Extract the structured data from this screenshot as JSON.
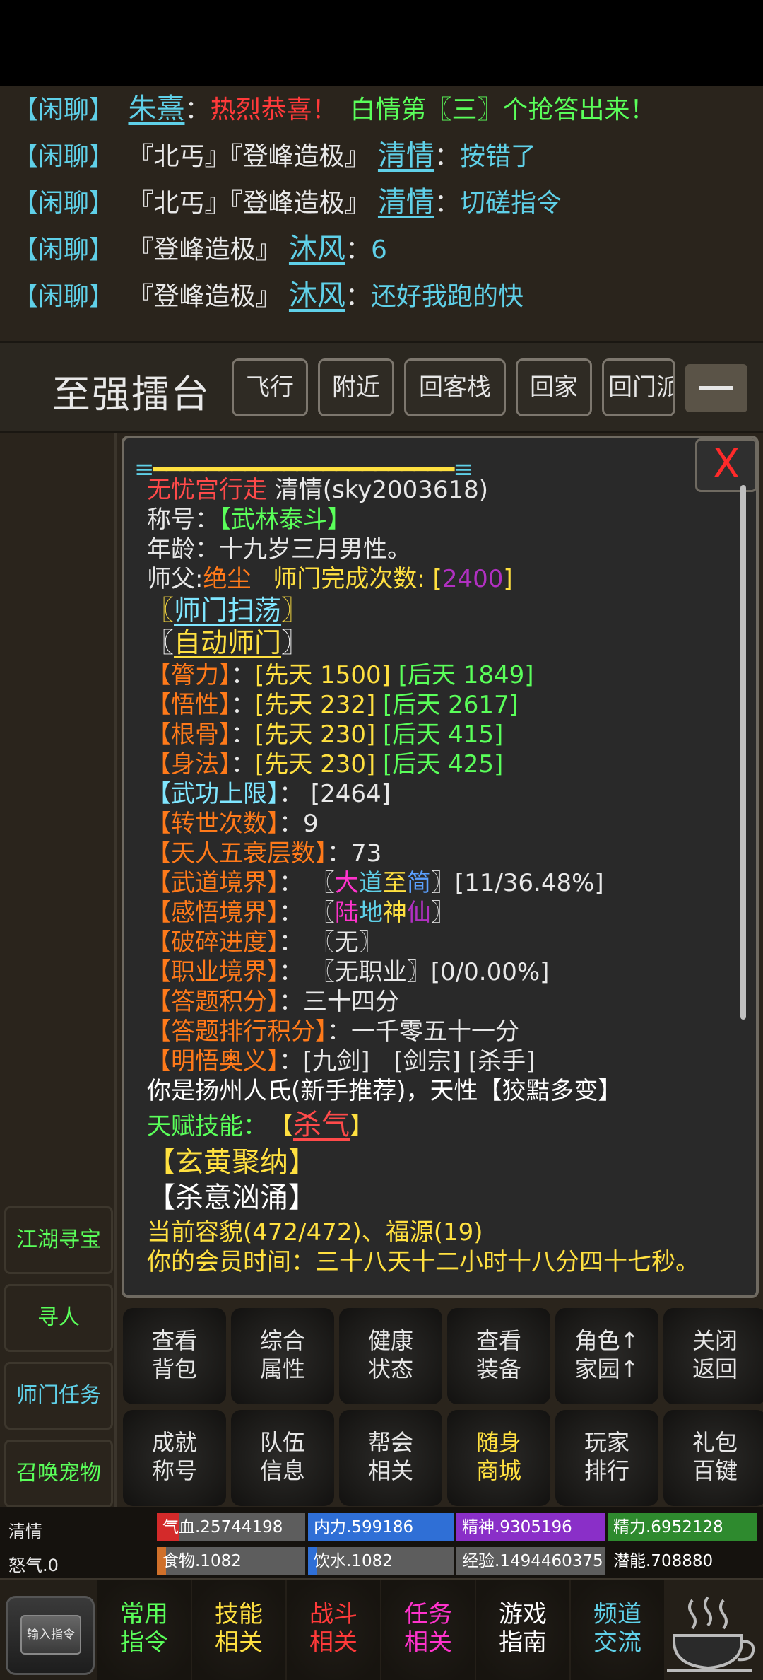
{
  "chat": {
    "lines": [
      {
        "tag": "【闲聊】",
        "title": "",
        "nick": "朱熹",
        "colon": "：",
        "msg_red": "热烈恭喜！",
        "msg_green": "白情第〖三〗个抢答出来！"
      },
      {
        "tag": "【闲聊】",
        "title": "『北丐』『登峰造极』",
        "nick": "清情",
        "colon": "：",
        "msg": "按错了"
      },
      {
        "tag": "【闲聊】",
        "title": "『北丐』『登峰造极』",
        "nick": "清情",
        "colon": "：",
        "msg": "切磋指令"
      },
      {
        "tag": "【闲聊】",
        "title": "『登峰造极』",
        "nick": "沐风",
        "colon": "：",
        "msg": "6"
      },
      {
        "tag": "【闲聊】",
        "title": "『登峰造极』",
        "nick": "沐风",
        "colon": "：",
        "msg": "还好我跑的快"
      }
    ]
  },
  "header": {
    "location": "至强擂台",
    "buttons": [
      "飞行",
      "附近",
      "回客栈",
      "回家",
      "回门派"
    ]
  },
  "side": {
    "buttons": [
      {
        "label": "江湖寻宝",
        "color": "#5aff5a"
      },
      {
        "label": "寻人",
        "color": "#5aff5a"
      },
      {
        "label": "师门任务",
        "color": "#5fd0e8"
      },
      {
        "label": "召唤宠物",
        "color": "#5aff5a"
      }
    ]
  },
  "panel": {
    "close": "X",
    "sect_name": "无忧宫行走",
    "player": "清情(sky2003618)",
    "title_label": "称号：",
    "title_value": "【武林泰斗】",
    "age": "年龄：十九岁三月男性。",
    "master_label": "师父:",
    "master_name": "绝尘",
    "sect_count_label": "师门完成次数: [",
    "sect_count": "2400",
    "sect_count_end": "]",
    "link1": "师门扫荡",
    "link2": "自动师门",
    "attrs": [
      {
        "name": "【膂力】",
        "colon": "：",
        "base": "[先天 1500]",
        "acq": "[后天 1849]"
      },
      {
        "name": "【悟性】",
        "colon": "：",
        "base": "[先天 232]",
        "acq": "[后天 2617]"
      },
      {
        "name": "【根骨】",
        "colon": "：",
        "base": "[先天 230]",
        "acq": "[后天 415]"
      },
      {
        "name": "【身法】",
        "colon": "：",
        "base": "[先天 230]",
        "acq": "[后天 425]"
      }
    ],
    "wugong_limit_label": "【武功上限】",
    "wugong_limit": "：  [2464]",
    "rebirth_label": "【转世次数】",
    "rebirth": "：9",
    "wushuai_label": "【天人五衰层数】",
    "wushuai": "：73",
    "wudao_label": "【武道境界】",
    "wudao_pre": "：  〖",
    "wudao_chars": [
      "大",
      "道",
      "至",
      "简"
    ],
    "wudao_post": "〗[11/36.48%]",
    "ganwu_label": "【感悟境界】",
    "ganwu_pre": "：  〖",
    "ganwu_chars": [
      "陆",
      "地",
      "神",
      "仙"
    ],
    "ganwu_post": "〗",
    "posui_label": "【破碎进度】",
    "posui": "：  〖无〗",
    "zhiye_label": "【职业境界】",
    "zhiye": "：  〖无职业〗[0/0.00%]",
    "dati_label": "【答题积分】",
    "dati": "：三十四分",
    "dati_rank_label": "【答题排行积分】",
    "dati_rank": "：一千零五十一分",
    "mingwu_label": "【明悟奥义】",
    "mingwu": "：[九剑]　[剑宗] [杀手]",
    "origin": "你是扬州人氏(新手推荐)，天性【狡黠多变】",
    "talent_label": "天赋技能：",
    "talent_open": "【",
    "talent_skill": "杀气",
    "talent_close": "】",
    "skill2": "【玄黄聚纳】",
    "skill3": "【杀意汹涌】",
    "looks": "当前容貌(472/472)、福源(19)",
    "vip": "你的会员时间：三十八天十二小时十八分四十七秒。"
  },
  "grid": {
    "buttons": [
      {
        "l1": "查看",
        "l2": "背包",
        "color": "#e6e6e6"
      },
      {
        "l1": "综合",
        "l2": "属性",
        "color": "#e6e6e6"
      },
      {
        "l1": "健康",
        "l2": "状态",
        "color": "#e6e6e6"
      },
      {
        "l1": "查看",
        "l2": "装备",
        "color": "#e6e6e6"
      },
      {
        "l1": "角色↑",
        "l2": "家园↑",
        "color": "#e6e6e6"
      },
      {
        "l1": "关闭",
        "l2": "返回",
        "color": "#e6e6e6"
      },
      {
        "l1": "成就",
        "l2": "称号",
        "color": "#e6e6e6"
      },
      {
        "l1": "队伍",
        "l2": "信息",
        "color": "#e6e6e6"
      },
      {
        "l1": "帮会",
        "l2": "相关",
        "color": "#e6e6e6"
      },
      {
        "l1": "随身",
        "l2": "商城",
        "color": "#ffe040"
      },
      {
        "l1": "玩家",
        "l2": "排行",
        "color": "#e6e6e6"
      },
      {
        "l1": "礼包",
        "l2": "百键",
        "color": "#e6e6e6"
      }
    ]
  },
  "stats": {
    "name": "清情",
    "rage": "怒气.0",
    "bars": [
      {
        "label": "气血.25744198",
        "color": "#d42a2a",
        "fill": 0.15
      },
      {
        "label": "内力.599186",
        "color": "#2f6fd6",
        "fill": 1.0
      },
      {
        "label": "精神.9305196",
        "color": "#8a2fc8",
        "fill": 1.0
      },
      {
        "label": "精力.6952128",
        "color": "#2e8a2e",
        "fill": 1.0
      },
      {
        "label": "食物.1082",
        "color": "#d0702a",
        "fill": 0.06
      },
      {
        "label": "饮水.1082",
        "color": "#2f6fd6",
        "fill": 0.06
      },
      {
        "label": "经验.1494460375",
        "color": "#5d5d5d",
        "fill": 0
      },
      {
        "label": "潜能.708880",
        "color": "#15120e",
        "fill": 0
      }
    ]
  },
  "bottom": {
    "cmd_label": "输入指令",
    "nav": [
      {
        "l1": "常用",
        "l2": "指令",
        "color": "#5aff5a"
      },
      {
        "l1": "技能",
        "l2": "相关",
        "color": "#ffe040"
      },
      {
        "l1": "战斗",
        "l2": "相关",
        "color": "#ff3a3a"
      },
      {
        "l1": "任务",
        "l2": "相关",
        "color": "#ff33cc"
      },
      {
        "l1": "游戏",
        "l2": "指南",
        "color": "#ffffff"
      },
      {
        "l1": "频道",
        "l2": "交流",
        "color": "#5fd0e8"
      }
    ],
    "teacup_icon": "teacup-icon"
  }
}
